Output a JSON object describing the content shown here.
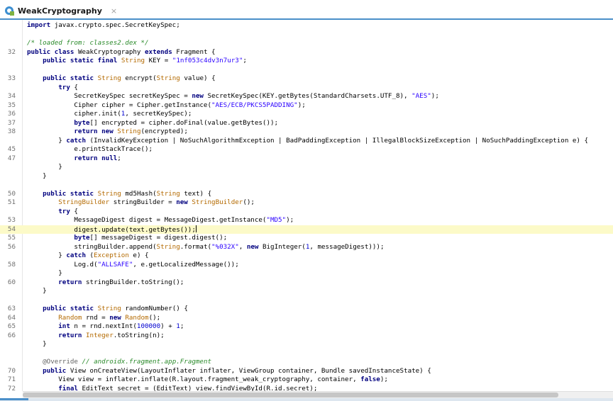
{
  "tab": {
    "title": "WeakCryptography",
    "close_glyph": "×",
    "icon": "java-class-icon"
  },
  "colors": {
    "keyword": "#00007f",
    "type": "#b46a00",
    "string": "#2a00ff",
    "comment": "#2a8a2a",
    "annotation": "#646464",
    "current_line": "#fcfac8",
    "tab_underline": "#4a8fc9"
  },
  "editor": {
    "current_line_number": "54",
    "lines": [
      {
        "num": "",
        "code": "import javax.crypto.spec.SecretKeySpec;"
      },
      {
        "num": "",
        "code": ""
      },
      {
        "num": "",
        "code": "/* loaded from: classes2.dex */"
      },
      {
        "num": "32",
        "code": "public class WeakCryptography extends Fragment {"
      },
      {
        "num": "",
        "code": "    public static final String KEY = \"1nf053c4dv3n7ur3\";"
      },
      {
        "num": "",
        "code": ""
      },
      {
        "num": "33",
        "code": "    public static String encrypt(String value) {"
      },
      {
        "num": "",
        "code": "        try {"
      },
      {
        "num": "34",
        "code": "            SecretKeySpec secretKeySpec = new SecretKeySpec(KEY.getBytes(StandardCharsets.UTF_8), \"AES\");"
      },
      {
        "num": "35",
        "code": "            Cipher cipher = Cipher.getInstance(\"AES/ECB/PKCS5PADDING\");"
      },
      {
        "num": "36",
        "code": "            cipher.init(1, secretKeySpec);"
      },
      {
        "num": "37",
        "code": "            byte[] encrypted = cipher.doFinal(value.getBytes());"
      },
      {
        "num": "38",
        "code": "            return new String(encrypted);"
      },
      {
        "num": "",
        "code": "        } catch (InvalidKeyException | NoSuchAlgorithmException | BadPaddingException | IllegalBlockSizeException | NoSuchPaddingException e) {"
      },
      {
        "num": "45",
        "code": "            e.printStackTrace();"
      },
      {
        "num": "47",
        "code": "            return null;"
      },
      {
        "num": "",
        "code": "        }"
      },
      {
        "num": "",
        "code": "    }"
      },
      {
        "num": "",
        "code": ""
      },
      {
        "num": "50",
        "code": "    public static String md5Hash(String text) {"
      },
      {
        "num": "51",
        "code": "        StringBuilder stringBuilder = new StringBuilder();"
      },
      {
        "num": "",
        "code": "        try {"
      },
      {
        "num": "53",
        "code": "            MessageDigest digest = MessageDigest.getInstance(\"MD5\");"
      },
      {
        "num": "54",
        "code": "            digest.update(text.getBytes());"
      },
      {
        "num": "55",
        "code": "            byte[] messageDigest = digest.digest();"
      },
      {
        "num": "56",
        "code": "            stringBuilder.append(String.format(\"%032X\", new BigInteger(1, messageDigest)));"
      },
      {
        "num": "",
        "code": "        } catch (Exception e) {"
      },
      {
        "num": "58",
        "code": "            Log.d(\"ALLSAFE\", e.getLocalizedMessage());"
      },
      {
        "num": "",
        "code": "        }"
      },
      {
        "num": "60",
        "code": "        return stringBuilder.toString();"
      },
      {
        "num": "",
        "code": "    }"
      },
      {
        "num": "",
        "code": ""
      },
      {
        "num": "63",
        "code": "    public static String randomNumber() {"
      },
      {
        "num": "64",
        "code": "        Random rnd = new Random();"
      },
      {
        "num": "65",
        "code": "        int n = rnd.nextInt(100000) + 1;"
      },
      {
        "num": "66",
        "code": "        return Integer.toString(n);"
      },
      {
        "num": "",
        "code": "    }"
      },
      {
        "num": "",
        "code": ""
      },
      {
        "num": "",
        "code": "    @Override // androidx.fragment.app.Fragment"
      },
      {
        "num": "70",
        "code": "    public View onCreateView(LayoutInflater inflater, ViewGroup container, Bundle savedInstanceState) {"
      },
      {
        "num": "71",
        "code": "        View view = inflater.inflate(R.layout.fragment_weak_cryptography, container, false);"
      },
      {
        "num": "72",
        "code": "        final EditText secret = (EditText) view.findViewById(R.id.secret);"
      }
    ]
  }
}
